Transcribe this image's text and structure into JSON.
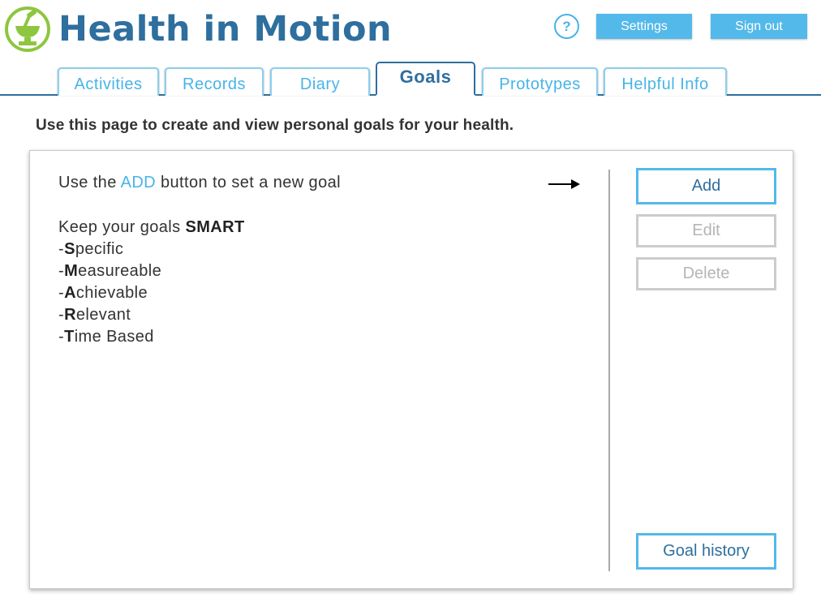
{
  "header": {
    "app_title": "Health in Motion",
    "logo_icon": "mortar-pestle-logo-icon",
    "help_label": "?",
    "settings_label": "Settings",
    "signout_label": "Sign out"
  },
  "tabs": [
    {
      "label": "Activities",
      "active": false
    },
    {
      "label": "Records",
      "active": false
    },
    {
      "label": "Diary",
      "active": false
    },
    {
      "label": "Goals",
      "active": true
    },
    {
      "label": "Prototypes",
      "active": false
    },
    {
      "label": "Helpful Info",
      "active": false
    }
  ],
  "intro": "Use this page to create and view personal goals for your health.",
  "panel": {
    "instruction_pre": "Use the ",
    "instruction_add": "ADD",
    "instruction_post": " button to set a new goal",
    "arrow_icon": "right-arrow-icon",
    "smart_prefix": "Keep your goals ",
    "smart_word": "SMART",
    "smart_items": [
      {
        "letter": "S",
        "rest": "pecific"
      },
      {
        "letter": "M",
        "rest": "easureable"
      },
      {
        "letter": "A",
        "rest": "chievable"
      },
      {
        "letter": "R",
        "rest": "elevant"
      },
      {
        "letter": "T",
        "rest": "ime Based"
      }
    ]
  },
  "actions": {
    "add_label": "Add",
    "edit_label": "Edit",
    "delete_label": "Delete",
    "history_label": "Goal history"
  },
  "colors": {
    "brand_dark": "#2e6f9e",
    "accent": "#47b4e8",
    "button_fill": "#53b9ea",
    "logo_green": "#8dc63f",
    "disabled": "#cccccc"
  }
}
